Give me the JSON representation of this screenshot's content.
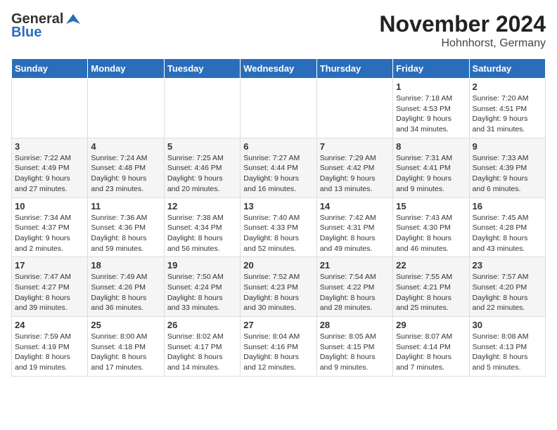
{
  "logo": {
    "line1": "General",
    "line2": "Blue"
  },
  "title": "November 2024",
  "subtitle": "Hohnhorst, Germany",
  "weekdays": [
    "Sunday",
    "Monday",
    "Tuesday",
    "Wednesday",
    "Thursday",
    "Friday",
    "Saturday"
  ],
  "weeks": [
    [
      {
        "day": "",
        "info": ""
      },
      {
        "day": "",
        "info": ""
      },
      {
        "day": "",
        "info": ""
      },
      {
        "day": "",
        "info": ""
      },
      {
        "day": "",
        "info": ""
      },
      {
        "day": "1",
        "info": "Sunrise: 7:18 AM\nSunset: 4:53 PM\nDaylight: 9 hours\nand 34 minutes."
      },
      {
        "day": "2",
        "info": "Sunrise: 7:20 AM\nSunset: 4:51 PM\nDaylight: 9 hours\nand 31 minutes."
      }
    ],
    [
      {
        "day": "3",
        "info": "Sunrise: 7:22 AM\nSunset: 4:49 PM\nDaylight: 9 hours\nand 27 minutes."
      },
      {
        "day": "4",
        "info": "Sunrise: 7:24 AM\nSunset: 4:48 PM\nDaylight: 9 hours\nand 23 minutes."
      },
      {
        "day": "5",
        "info": "Sunrise: 7:25 AM\nSunset: 4:46 PM\nDaylight: 9 hours\nand 20 minutes."
      },
      {
        "day": "6",
        "info": "Sunrise: 7:27 AM\nSunset: 4:44 PM\nDaylight: 9 hours\nand 16 minutes."
      },
      {
        "day": "7",
        "info": "Sunrise: 7:29 AM\nSunset: 4:42 PM\nDaylight: 9 hours\nand 13 minutes."
      },
      {
        "day": "8",
        "info": "Sunrise: 7:31 AM\nSunset: 4:41 PM\nDaylight: 9 hours\nand 9 minutes."
      },
      {
        "day": "9",
        "info": "Sunrise: 7:33 AM\nSunset: 4:39 PM\nDaylight: 9 hours\nand 6 minutes."
      }
    ],
    [
      {
        "day": "10",
        "info": "Sunrise: 7:34 AM\nSunset: 4:37 PM\nDaylight: 9 hours\nand 2 minutes."
      },
      {
        "day": "11",
        "info": "Sunrise: 7:36 AM\nSunset: 4:36 PM\nDaylight: 8 hours\nand 59 minutes."
      },
      {
        "day": "12",
        "info": "Sunrise: 7:38 AM\nSunset: 4:34 PM\nDaylight: 8 hours\nand 56 minutes."
      },
      {
        "day": "13",
        "info": "Sunrise: 7:40 AM\nSunset: 4:33 PM\nDaylight: 8 hours\nand 52 minutes."
      },
      {
        "day": "14",
        "info": "Sunrise: 7:42 AM\nSunset: 4:31 PM\nDaylight: 8 hours\nand 49 minutes."
      },
      {
        "day": "15",
        "info": "Sunrise: 7:43 AM\nSunset: 4:30 PM\nDaylight: 8 hours\nand 46 minutes."
      },
      {
        "day": "16",
        "info": "Sunrise: 7:45 AM\nSunset: 4:28 PM\nDaylight: 8 hours\nand 43 minutes."
      }
    ],
    [
      {
        "day": "17",
        "info": "Sunrise: 7:47 AM\nSunset: 4:27 PM\nDaylight: 8 hours\nand 39 minutes."
      },
      {
        "day": "18",
        "info": "Sunrise: 7:49 AM\nSunset: 4:26 PM\nDaylight: 8 hours\nand 36 minutes."
      },
      {
        "day": "19",
        "info": "Sunrise: 7:50 AM\nSunset: 4:24 PM\nDaylight: 8 hours\nand 33 minutes."
      },
      {
        "day": "20",
        "info": "Sunrise: 7:52 AM\nSunset: 4:23 PM\nDaylight: 8 hours\nand 30 minutes."
      },
      {
        "day": "21",
        "info": "Sunrise: 7:54 AM\nSunset: 4:22 PM\nDaylight: 8 hours\nand 28 minutes."
      },
      {
        "day": "22",
        "info": "Sunrise: 7:55 AM\nSunset: 4:21 PM\nDaylight: 8 hours\nand 25 minutes."
      },
      {
        "day": "23",
        "info": "Sunrise: 7:57 AM\nSunset: 4:20 PM\nDaylight: 8 hours\nand 22 minutes."
      }
    ],
    [
      {
        "day": "24",
        "info": "Sunrise: 7:59 AM\nSunset: 4:19 PM\nDaylight: 8 hours\nand 19 minutes."
      },
      {
        "day": "25",
        "info": "Sunrise: 8:00 AM\nSunset: 4:18 PM\nDaylight: 8 hours\nand 17 minutes."
      },
      {
        "day": "26",
        "info": "Sunrise: 8:02 AM\nSunset: 4:17 PM\nDaylight: 8 hours\nand 14 minutes."
      },
      {
        "day": "27",
        "info": "Sunrise: 8:04 AM\nSunset: 4:16 PM\nDaylight: 8 hours\nand 12 minutes."
      },
      {
        "day": "28",
        "info": "Sunrise: 8:05 AM\nSunset: 4:15 PM\nDaylight: 8 hours\nand 9 minutes."
      },
      {
        "day": "29",
        "info": "Sunrise: 8:07 AM\nSunset: 4:14 PM\nDaylight: 8 hours\nand 7 minutes."
      },
      {
        "day": "30",
        "info": "Sunrise: 8:08 AM\nSunset: 4:13 PM\nDaylight: 8 hours\nand 5 minutes."
      }
    ]
  ]
}
